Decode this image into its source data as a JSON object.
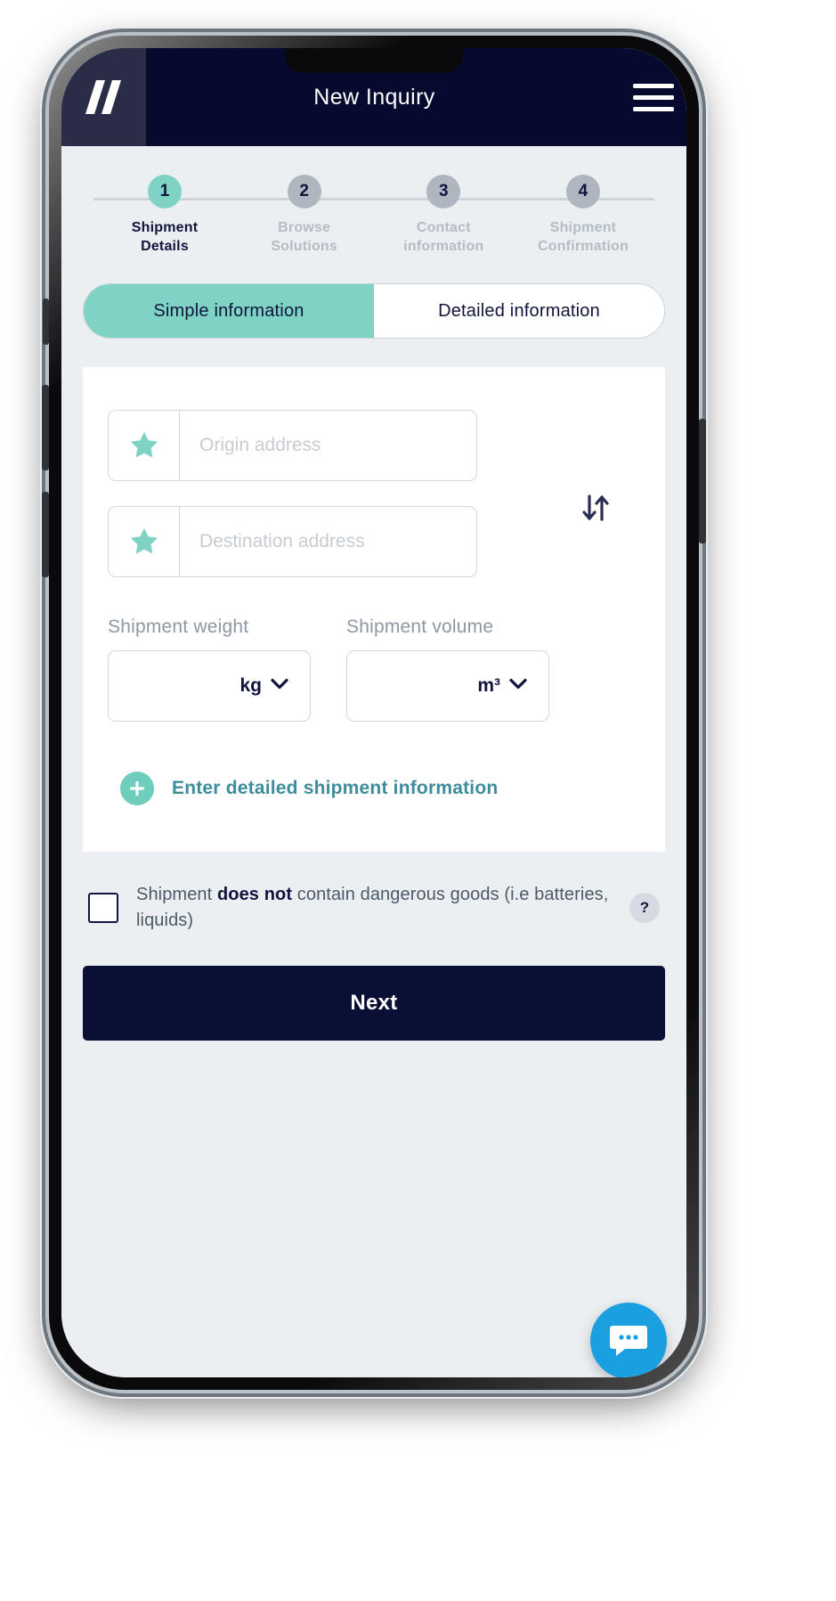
{
  "header": {
    "title": "New Inquiry",
    "logo_name": "double-slash-logo",
    "menu_name": "hamburger-menu"
  },
  "stepper": {
    "steps": [
      {
        "number": "1",
        "line1": "Shipment",
        "line2": "Details",
        "active": true
      },
      {
        "number": "2",
        "line1": "Browse",
        "line2": "Solutions",
        "active": false
      },
      {
        "number": "3",
        "line1": "Contact",
        "line2": "information",
        "active": false
      },
      {
        "number": "4",
        "line1": "Shipment",
        "line2": "Confirmation",
        "active": false
      }
    ]
  },
  "tabs": [
    {
      "label": "Simple information",
      "active": true
    },
    {
      "label": "Detailed information",
      "active": false
    }
  ],
  "form": {
    "origin": {
      "placeholder": "Origin address",
      "value": ""
    },
    "destination": {
      "placeholder": "Destination address",
      "value": ""
    },
    "swap_icon": "swap-vertical-arrows-icon",
    "weight": {
      "label": "Shipment weight",
      "unit": "kg",
      "value": ""
    },
    "volume": {
      "label": "Shipment volume",
      "unit": "m³",
      "value": ""
    },
    "detailed_link": "Enter detailed shipment information"
  },
  "dangerous_goods": {
    "text_before": "Shipment ",
    "text_bold": "does not",
    "text_after": " contain dangerous goods (i.e batteries, liquids)",
    "checked": false,
    "help_label": "?"
  },
  "next_button": "Next",
  "chat_widget": "chat-bubble-icon",
  "colors": {
    "header_bg": "#060a2e",
    "logo_bg": "#2b2d46",
    "accent_teal": "#7ed3c4",
    "screen_bg": "#eceff2",
    "card_bg": "#ffffff",
    "step_inactive": "#aeb6bf",
    "link_teal": "#3e8d9c",
    "next_bg": "#0a0f35",
    "chat_blue": "#1a9fe0"
  }
}
